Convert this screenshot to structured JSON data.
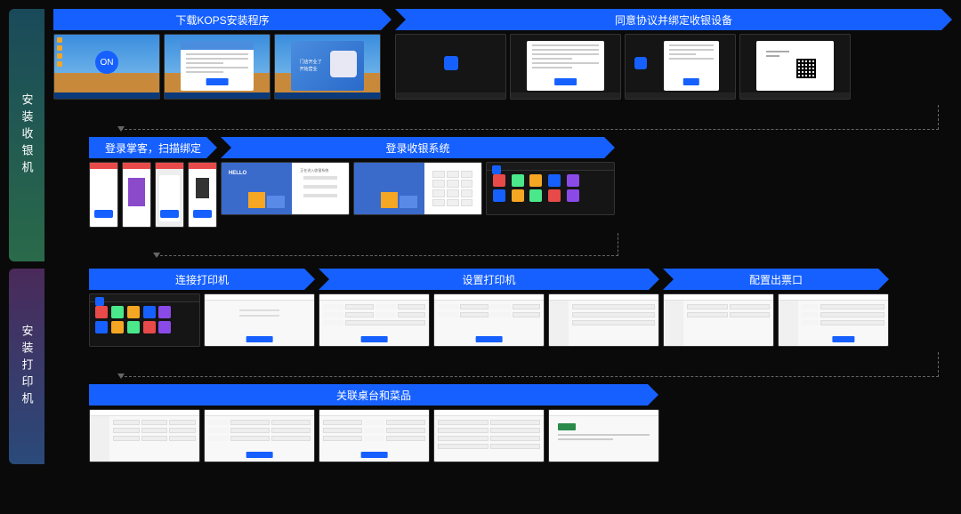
{
  "sections": [
    {
      "label": "安装收银机",
      "rows": [
        {
          "steps": [
            {
              "title": "下载KOPS安装程序",
              "thumbs": [
                "desktop-logo",
                "installer-text",
                "installer-promo"
              ]
            },
            {
              "title": "同意协议并绑定收银设备",
              "thumbs": [
                "dark-loading",
                "agreement",
                "bind-device",
                "bind-qr"
              ]
            }
          ]
        },
        {
          "steps": [
            {
              "title": "登录掌客，扫描绑定",
              "thumbs": [
                "mobile-1",
                "mobile-qr",
                "mobile-3",
                "mobile-4"
              ]
            },
            {
              "title": "登录收银系统",
              "thumbs": [
                "login-hello",
                "login-keypad",
                "pos-home"
              ]
            }
          ]
        }
      ]
    },
    {
      "label": "安装打印机",
      "rows": [
        {
          "steps": [
            {
              "title": "连接打印机",
              "thumbs": [
                "pos-home-2",
                "printer-connect"
              ]
            },
            {
              "title": "设置打印机",
              "thumbs": [
                "printer-set-1",
                "printer-set-2",
                "printer-set-3"
              ]
            },
            {
              "title": "配置出票口",
              "thumbs": [
                "ticket-1",
                "ticket-2"
              ]
            }
          ]
        },
        {
          "steps": [
            {
              "title": "关联桌台和菜品",
              "thumbs": [
                "table-1",
                "table-2",
                "table-3",
                "table-4",
                "table-5"
              ]
            }
          ]
        }
      ]
    }
  ],
  "illustration_text": {
    "hello": "HELLO",
    "login_hint": "正在进入收银系统",
    "promo_line1": "门店开业了",
    "promo_line2": "开始营业"
  }
}
